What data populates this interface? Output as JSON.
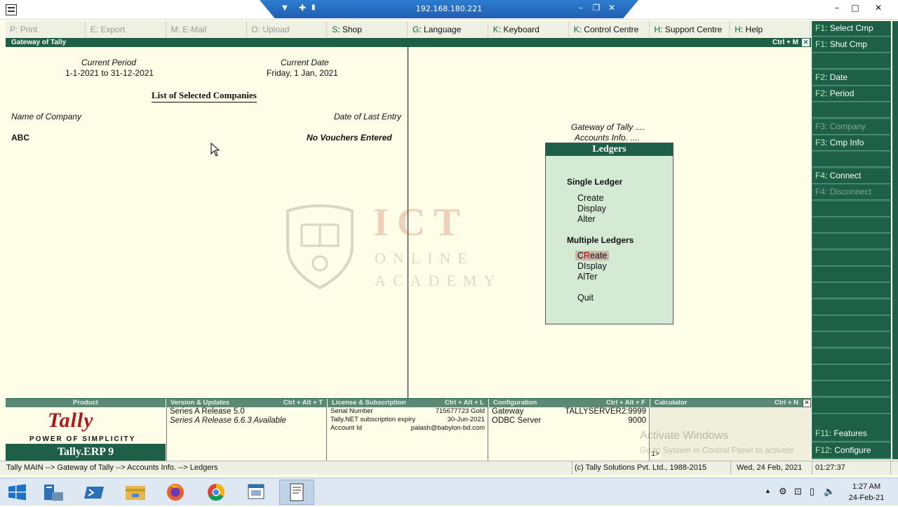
{
  "window": {
    "app_icon": "tally-app-icon",
    "rdp_host": "192.168.180.221"
  },
  "menubar": [
    {
      "key": "P",
      "label": "Print",
      "enabled": false
    },
    {
      "key": "E",
      "label": "Export",
      "enabled": false
    },
    {
      "key": "M",
      "label": "E-Mail",
      "enabled": false
    },
    {
      "key": "O",
      "label": "Upload",
      "enabled": false
    },
    {
      "key": "S",
      "label": "Shop",
      "enabled": true
    },
    {
      "key": "G",
      "label": "Language",
      "enabled": true
    },
    {
      "key": "K",
      "label": "Keyboard",
      "enabled": true
    },
    {
      "key": "K",
      "label": "Control Centre",
      "enabled": true
    },
    {
      "key": "H",
      "label": "Support Centre",
      "enabled": true
    },
    {
      "key": "H",
      "label": "Help",
      "enabled": true
    }
  ],
  "gateway_bar": {
    "title": "Gateway of Tally",
    "shortcut": "Ctrl + M"
  },
  "left_pane": {
    "current_period_label": "Current Period",
    "current_period": "1-1-2021 to 31-12-2021",
    "current_date_label": "Current Date",
    "current_date": "Friday, 1 Jan, 2021",
    "list_title": "List of Selected Companies",
    "col_company": "Name of Company",
    "col_last_entry": "Date of Last Entry",
    "companies": [
      {
        "name": "ABC",
        "last_entry": "No Vouchers Entered"
      }
    ]
  },
  "watermark": {
    "line1": "ICT",
    "line2": "ONLINE",
    "line3": "ACADEMY"
  },
  "breadcrumb_menu": {
    "line1": "Gateway of Tally ....",
    "line2": "Accounts Info. ...."
  },
  "ledgers_menu": {
    "title": "Ledgers",
    "single_heading": "Single Ledger",
    "single_items": [
      {
        "pre": "",
        "hot": "C",
        "post": "reate"
      },
      {
        "pre": "",
        "hot": "D",
        "post": "isplay"
      },
      {
        "pre": "",
        "hot": "A",
        "post": "lter"
      }
    ],
    "multiple_heading": "Multiple Ledgers",
    "multiple_items": [
      {
        "pre": "C",
        "hot": "R",
        "post": "eate",
        "selected": true
      },
      {
        "pre": "D",
        "hot": "I",
        "post": "splay",
        "selected": false
      },
      {
        "pre": "A",
        "hot": "l",
        "post": "Ter",
        "selected": false
      }
    ],
    "quit": {
      "pre": "",
      "hot": "Q",
      "post": "uit"
    }
  },
  "right_buttons": [
    {
      "key": "F1",
      "label": "Select Cmp",
      "enabled": true
    },
    {
      "key": "F1",
      "label": "Shut Cmp",
      "enabled": true
    },
    {
      "key": "",
      "label": "",
      "enabled": false
    },
    {
      "key": "F2",
      "label": "Date",
      "enabled": true
    },
    {
      "key": "F2",
      "label": "Period",
      "enabled": true
    },
    {
      "key": "",
      "label": "",
      "enabled": false
    },
    {
      "key": "F3",
      "label": "Company",
      "enabled": false
    },
    {
      "key": "F3",
      "label": "Cmp Info",
      "enabled": true
    },
    {
      "key": "",
      "label": "",
      "enabled": false
    },
    {
      "key": "F4",
      "label": "Connect",
      "enabled": true
    },
    {
      "key": "F4",
      "label": "Disconnect",
      "enabled": false
    },
    {
      "key": "F11",
      "label": "Features",
      "enabled": true
    },
    {
      "key": "F12",
      "label": "Configure",
      "enabled": true
    }
  ],
  "info_panel": {
    "product_header": "Product",
    "product_tagline": "POWER OF SIMPLICITY",
    "product_name": "Tally.ERP 9",
    "version_header": "Version & Updates",
    "version_shortcut": "Ctrl + Alt + T",
    "version_line1": "Series A Release 5.0",
    "version_line2": "Series A Release 6.6.3 Available",
    "license_header": "License & Subscription",
    "license_shortcut": "Ctrl + Alt + L",
    "serial_label": "Serial Number",
    "serial_value": "715677723 Gold",
    "expiry_label": "Tally.NET subscription expiry",
    "expiry_value": "30-Jun-2021",
    "account_label": "Account Id",
    "account_value": "palash@babylon-bd.com",
    "config_header": "Configuration",
    "config_shortcut": "Ctrl + Alt + F",
    "gateway_label": "Gateway",
    "gateway_value": "TALLYSERVER2:9999",
    "odbc_label": "ODBC Server",
    "odbc_value": "9000",
    "calc_header": "Calculator",
    "calc_shortcut": "Ctrl + N",
    "calc_prompt": "1>"
  },
  "activation": {
    "line1": "Activate Windows",
    "line2": "Go to System in Control Panel to activate"
  },
  "statusbar": {
    "path": "Tally MAIN --> Gateway of Tally --> Accounts Info. --> Ledgers",
    "copyright": "(c) Tally Solutions Pvt. Ltd., 1988-2015",
    "date": "Wed, 24 Feb, 2021",
    "time": "01:27:37"
  },
  "taskbar": {
    "clock_time": "1:27 AM",
    "clock_date": "24-Feb-21"
  }
}
